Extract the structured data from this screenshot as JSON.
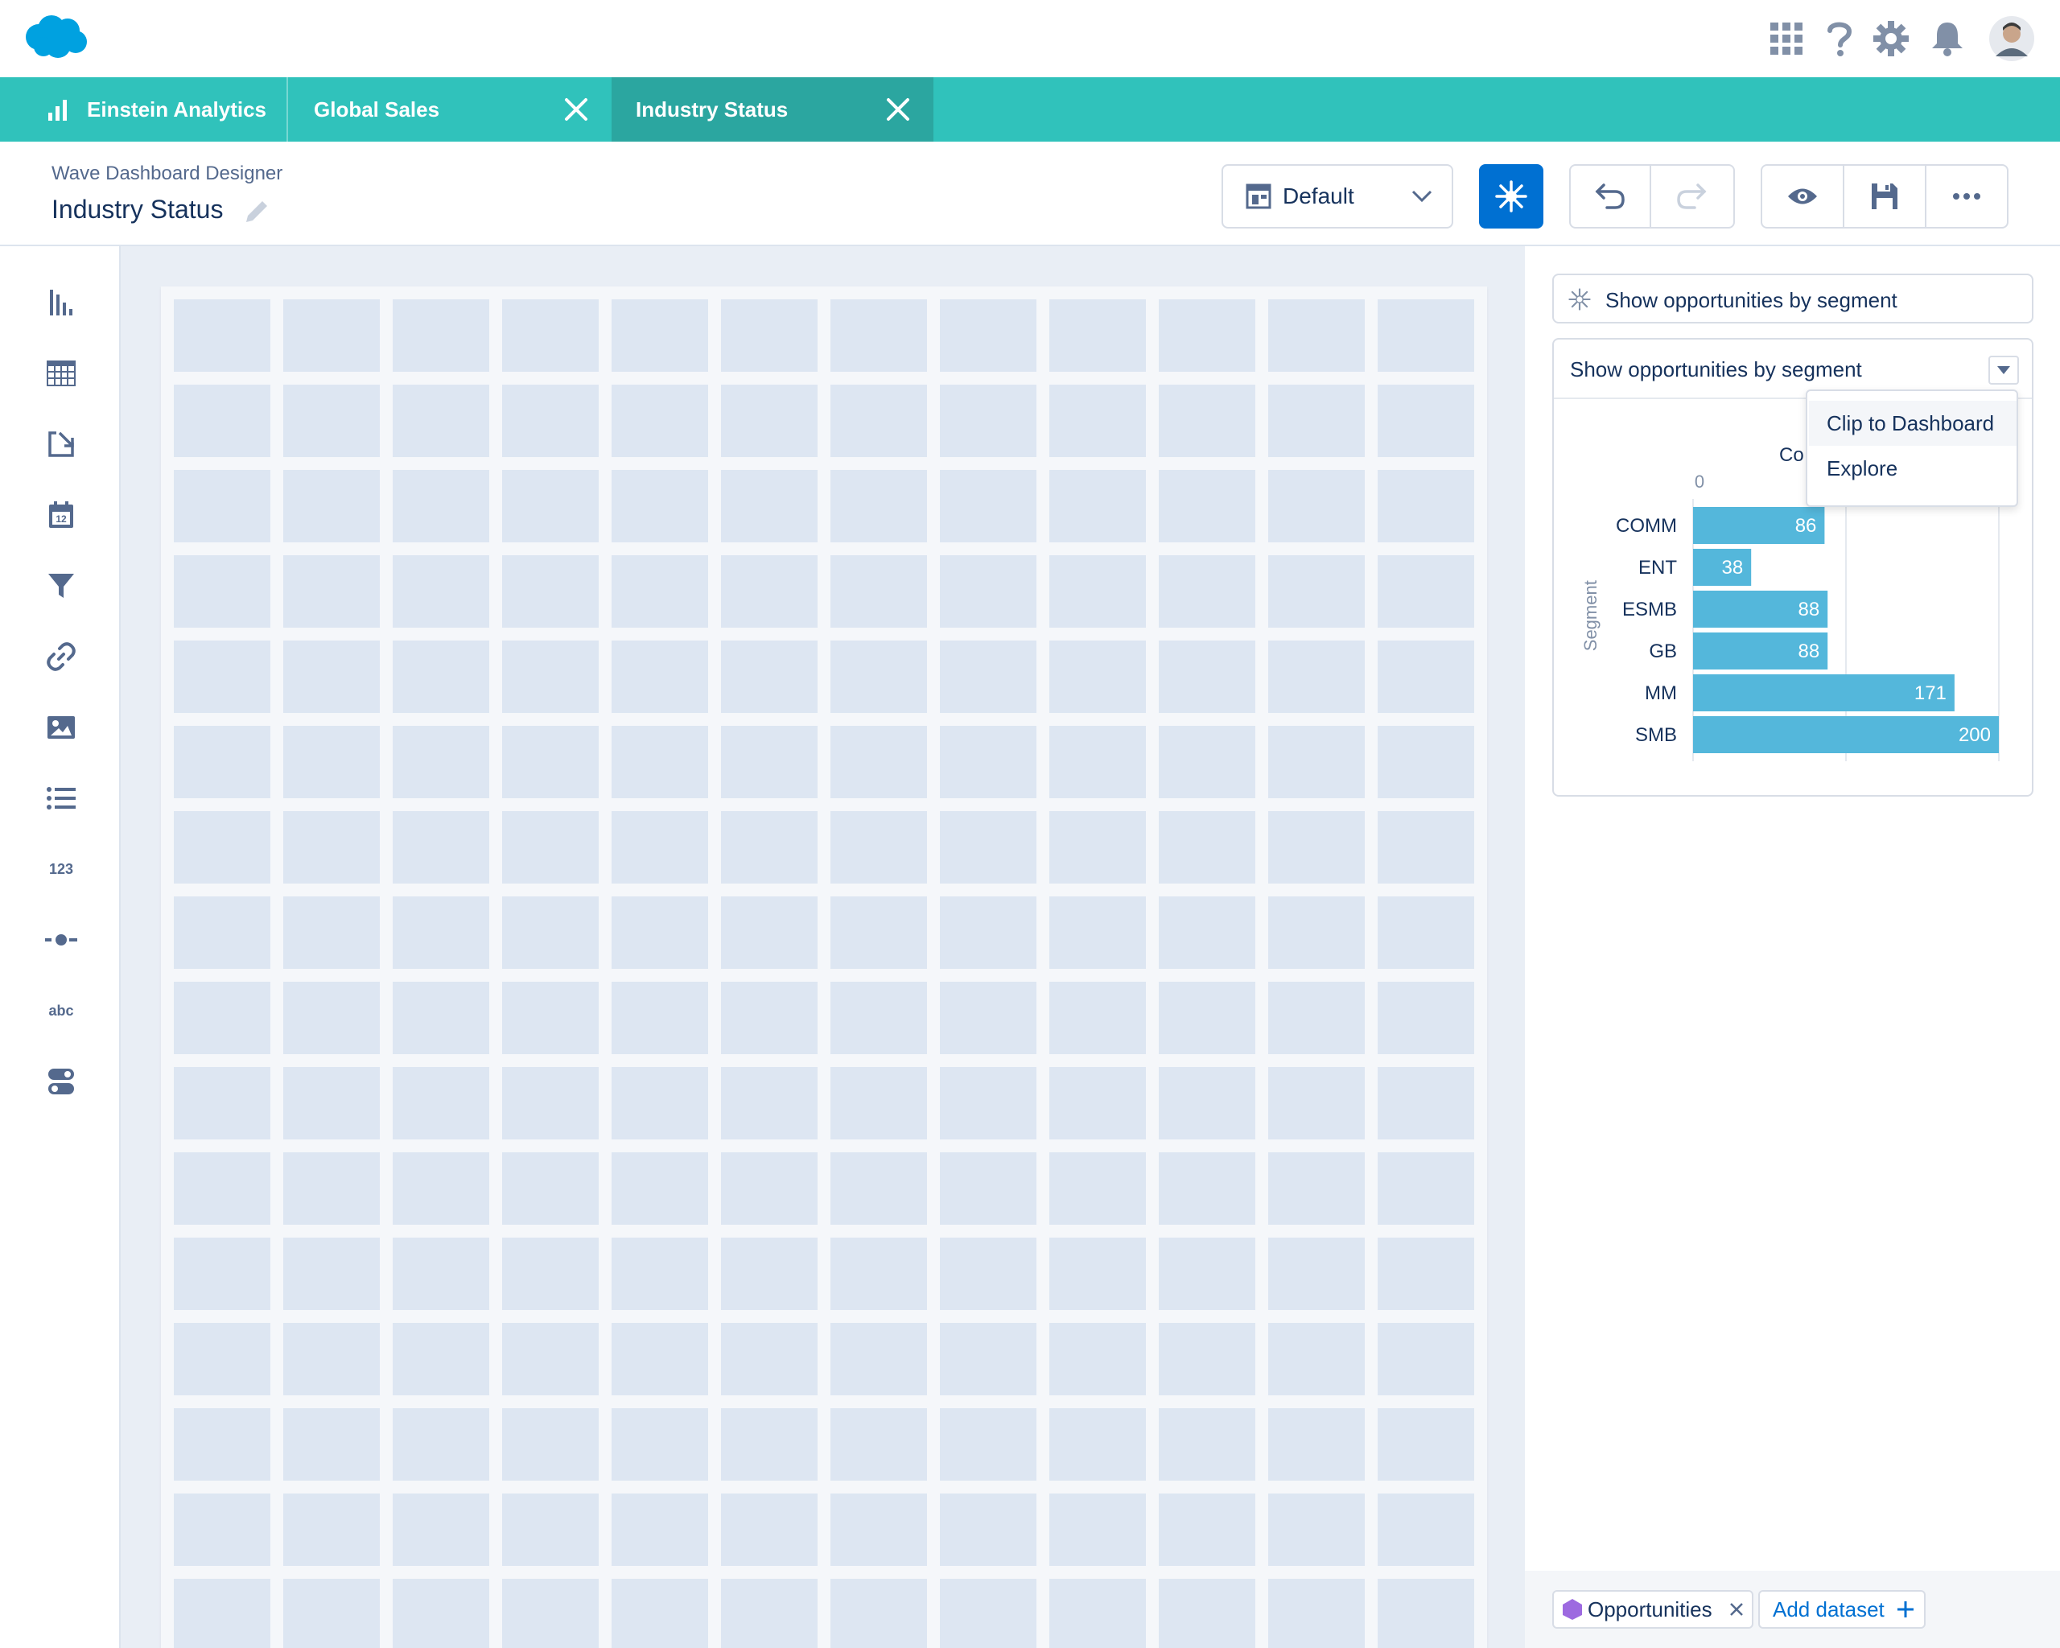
{
  "tabs": {
    "app_label": "Einstein Analytics",
    "items": [
      {
        "label": "Global Sales"
      },
      {
        "label": "Industry Status"
      }
    ]
  },
  "header": {
    "subtitle": "Wave Dashboard Designer",
    "title": "Industry Status",
    "layout_select": "Default"
  },
  "right_panel": {
    "search_label": "Show opportunities by segment",
    "card_title": "Show opportunities by segment",
    "chart_title_partial": "Co",
    "menu": [
      "Clip to Dashboard",
      "Explore"
    ],
    "footer": {
      "dataset": "Opportunities",
      "add_dataset": "Add dataset"
    }
  },
  "left_tools": [
    "chart-icon",
    "table-icon",
    "compare-table-icon",
    "date-icon",
    "filter-icon",
    "link-icon",
    "image-icon",
    "list-icon",
    "number-icon",
    "range-icon",
    "text-icon",
    "toggle-icon"
  ],
  "colors": {
    "teal": "#30c2bb",
    "brand_blue": "#0070d2",
    "bar": "#54b7db",
    "cell": "#dde6f2"
  },
  "chart_data": {
    "type": "bar",
    "orientation": "horizontal",
    "categories": [
      "COMM",
      "ENT",
      "ESMB",
      "GB",
      "MM",
      "SMB"
    ],
    "values": [
      86,
      38,
      88,
      88,
      171,
      200
    ],
    "ylabel": "Segment",
    "xtick_visible": "0",
    "xlim": [
      0,
      200
    ]
  }
}
